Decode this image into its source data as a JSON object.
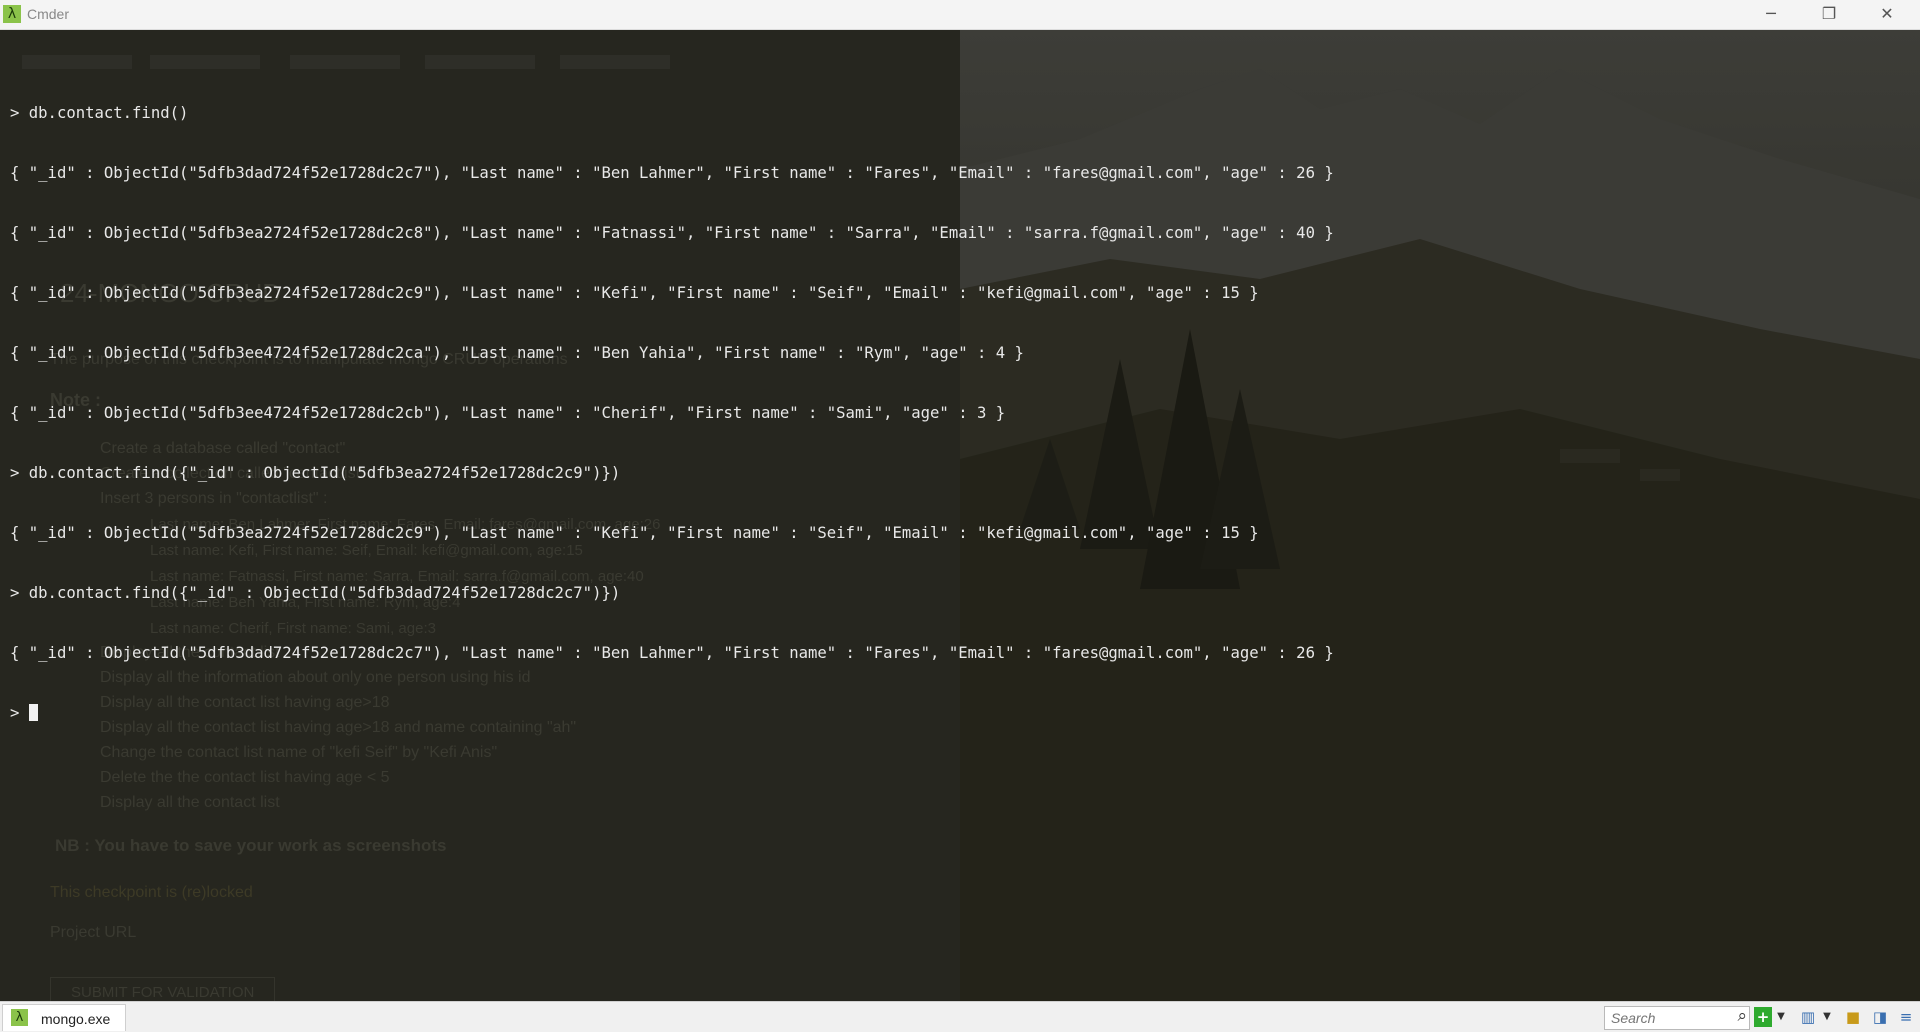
{
  "window": {
    "title": "Cmder",
    "controls": {
      "minimize": "─",
      "restore": "❐",
      "close": "✕"
    }
  },
  "console": {
    "lines": [
      "> db.contact.find()",
      "{ \"_id\" : ObjectId(\"5dfb3dad724f52e1728dc2c7\"), \"Last name\" : \"Ben Lahmer\", \"First name\" : \"Fares\", \"Email\" : \"fares@gmail.com\", \"age\" : 26 }",
      "{ \"_id\" : ObjectId(\"5dfb3ea2724f52e1728dc2c8\"), \"Last name\" : \"Fatnassi\", \"First name\" : \"Sarra\", \"Email\" : \"sarra.f@gmail.com\", \"age\" : 40 }",
      "{ \"_id\" : ObjectId(\"5dfb3ea2724f52e1728dc2c9\"), \"Last name\" : \"Kefi\", \"First name\" : \"Seif\", \"Email\" : \"kefi@gmail.com\", \"age\" : 15 }",
      "{ \"_id\" : ObjectId(\"5dfb3ee4724f52e1728dc2ca\"), \"Last name\" : \"Ben Yahia\", \"First name\" : \"Rym\", \"age\" : 4 }",
      "{ \"_id\" : ObjectId(\"5dfb3ee4724f52e1728dc2cb\"), \"Last name\" : \"Cherif\", \"First name\" : \"Sami\", \"age\" : 3 }",
      "> db.contact.find({\"_id\" : ObjectId(\"5dfb3ea2724f52e1728dc2c9\")})",
      "{ \"_id\" : ObjectId(\"5dfb3ea2724f52e1728dc2c9\"), \"Last name\" : \"Kefi\", \"First name\" : \"Seif\", \"Email\" : \"kefi@gmail.com\", \"age\" : 15 }",
      "> db.contact.find({\"_id\" : ObjectId(\"5dfb3dad724f52e1728dc2c7\")})",
      "{ \"_id\" : ObjectId(\"5dfb3dad724f52e1728dc2c7\"), \"Last name\" : \"Ben Lahmer\", \"First name\" : \"Fares\", \"Email\" : \"fares@gmail.com\", \"age\" : 26 }"
    ],
    "prompt": "> "
  },
  "background_doc": {
    "heading": "24-MONGO CRUD",
    "purpose": "The purpose of this checkpoint is to manipulate mongo CRUD operations",
    "note_label": "Note :",
    "steps": [
      "Create a database called \"contact\"",
      "Create a collection called \"contactlist\"",
      "Insert 3 persons in \"contactlist\" :"
    ],
    "persons": [
      "Last name: Ben Lahmer, First name: Fares, Email: fares@gmail.com, age:26",
      "Last name: Kefi, First name: Seif, Email: kefi@gmail.com, age:15",
      "Last name: Fatnassi, First name: Sarra, Email: sarra.f@gmail.com, age:40",
      "Last name: Ben Yahia, First name: Rym, age:4",
      "Last name: Cherif, First name: Sami, age:3"
    ],
    "tasks": [
      "Display all the contact list",
      "Display all the information about only one person using his id",
      "Display all the contact list having age>18",
      "Display all the contact list having age>18 and name containing \"ah\"",
      "Change the contact list name of \"kefi Seif\" by \"Kefi Anis\"",
      "Delete the the contact list having age < 5",
      "Display all the contact list"
    ],
    "nb": "NB : You have to save your work as screenshots",
    "locked": "This checkpoint is (re)locked",
    "project_url": "Project URL",
    "submit": "SUBMIT FOR VALIDATION"
  },
  "statusbar": {
    "tab_label": "mongo.exe",
    "search_placeholder": "Search",
    "icons": [
      "search-icon",
      "add-console-icon",
      "dropdown-arrow-icon",
      "layout-icon",
      "lock-icon",
      "split-icon",
      "menu-icon"
    ]
  },
  "colors": {
    "console_text": "#e8e8e8",
    "console_bg": "#26261f",
    "accent_green": "#8bc34a"
  }
}
